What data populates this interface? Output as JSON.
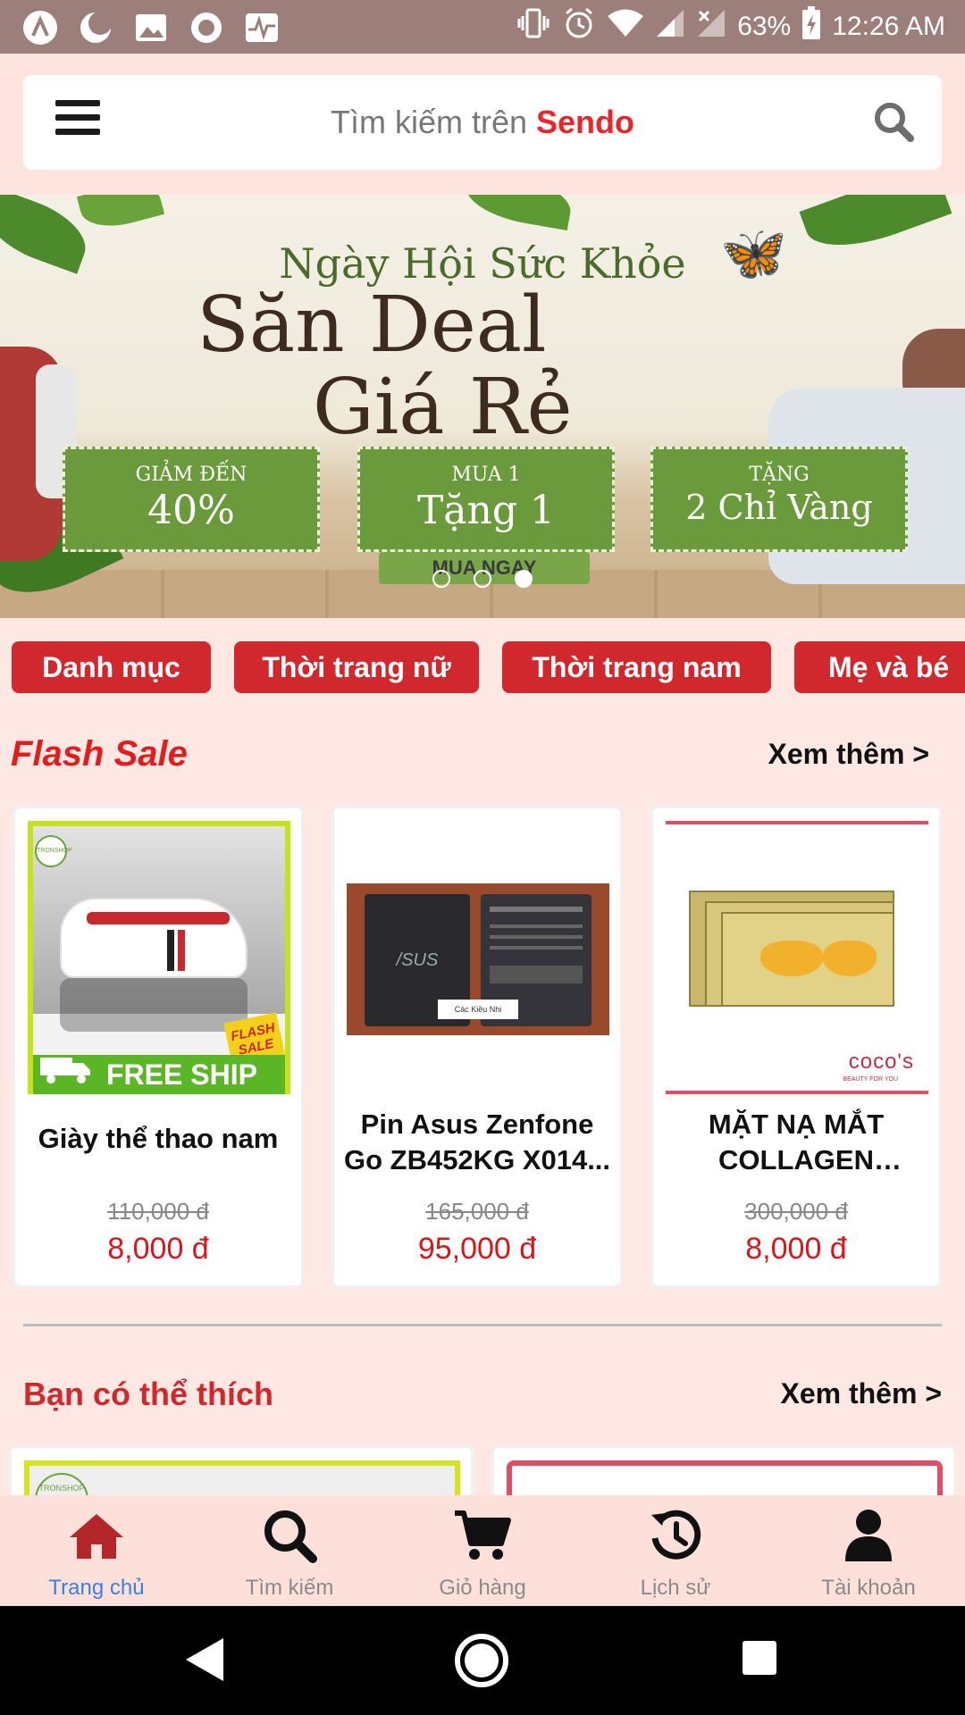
{
  "status_bar": {
    "battery": "63%",
    "time": "12:26 AM",
    "left_icons": [
      "app-logo-icon",
      "moon-icon",
      "image-icon",
      "record-icon",
      "pulse-icon"
    ],
    "right_icons": [
      "vibrate-icon",
      "alarm-icon",
      "wifi-icon",
      "signal-icon",
      "signal-off-icon",
      "battery-charging-icon"
    ]
  },
  "search": {
    "placeholder_prefix": "Tìm kiếm trên",
    "brand": "Sendo",
    "brand_color": "#e8262b"
  },
  "banner": {
    "subtitle": "Ngày Hội Sức Khỏe",
    "title_line1": "Săn Deal",
    "title_line2": "Giá Rẻ",
    "promos": [
      {
        "small": "GIẢM ĐẾN",
        "big": "40%"
      },
      {
        "small": "MUA 1",
        "big": "Tặng 1"
      },
      {
        "small": "TẶNG",
        "big": "2 Chỉ Vàng"
      }
    ],
    "cta": "MUA NGAY",
    "slide_count": 3,
    "active_slide": 3
  },
  "categories": [
    "Danh mục",
    "Thời trang nữ",
    "Thời trang nam",
    "Mẹ và bé"
  ],
  "flash_sale": {
    "title": "Flash Sale",
    "more": "Xem thêm >",
    "products": [
      {
        "name": "Giày thể thao nam",
        "old_price": "110,000 đ",
        "price": "8,000 đ",
        "badge": "FREE SHIP",
        "shop": "TRONSHOP",
        "sale_tag": "FLASH SALE"
      },
      {
        "name": "Pin Asus Zenfone Go ZB452KG X014...",
        "old_price": "165,000 đ",
        "price": "95,000 đ",
        "watermark": "Các Kiều Nhi"
      },
      {
        "name": "MẶT NẠ MẮT COLLAGEN CRYST...",
        "old_price": "300,000 đ",
        "price": "8,000 đ",
        "brand": "coco's",
        "brand_sub": "BEAUTY FOR YOU"
      }
    ]
  },
  "suggestions": {
    "title": "Bạn có thể thích",
    "more": "Xem thêm >",
    "first_card_shop": "TRONSHOP"
  },
  "bottom_nav": {
    "items": [
      {
        "label": "Trang chủ",
        "icon": "home-icon",
        "active": true
      },
      {
        "label": "Tìm kiếm",
        "icon": "search-icon",
        "active": false
      },
      {
        "label": "Giỏ hàng",
        "icon": "cart-icon",
        "active": false
      },
      {
        "label": "Lịch sử",
        "icon": "history-icon",
        "active": false
      },
      {
        "label": "Tài khoản",
        "icon": "account-icon",
        "active": false
      }
    ],
    "active_color": "#3b7fe0",
    "home_icon_color": "#b3262a"
  },
  "system_nav": [
    "back-icon",
    "home-circle-icon",
    "recents-icon"
  ]
}
